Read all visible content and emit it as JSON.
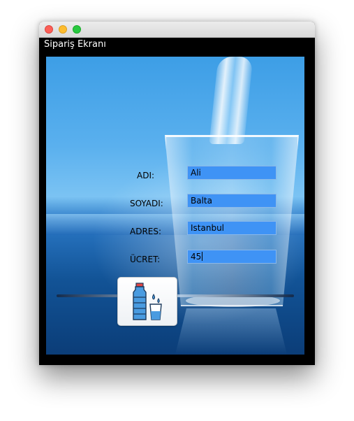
{
  "window": {
    "title": "Sipariş Ekranı"
  },
  "form": {
    "ad_label": "ADI:",
    "ad_value": "Ali",
    "soyad_label": "SOYADI:",
    "soyad_value": "Balta",
    "adres_label": "ADRES:",
    "adres_value": "Istanbul",
    "ucret_label": "ÜCRET:",
    "ucret_value": "45"
  },
  "order_button": {
    "icon": "water-bottle-and-glass-icon"
  },
  "colors": {
    "field_background": "#3f93f5",
    "window_background": "#000000"
  }
}
